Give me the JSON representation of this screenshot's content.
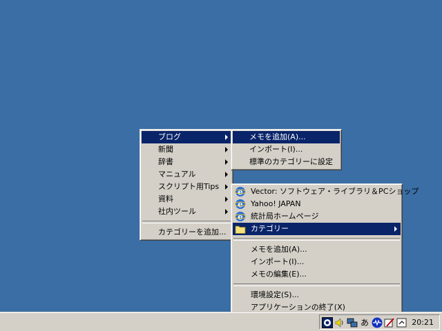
{
  "main_menu": {
    "items": [
      {
        "label": "ブログ",
        "submenu": true,
        "selected": true
      },
      {
        "label": "新聞",
        "submenu": true
      },
      {
        "label": "辞書",
        "submenu": true
      },
      {
        "label": "マニュアル",
        "submenu": true
      },
      {
        "label": "スクリプト用Tips",
        "submenu": true
      },
      {
        "label": "資料",
        "submenu": true
      },
      {
        "label": "社内ツール",
        "submenu": true
      }
    ],
    "add_category": "カテゴリーを追加..."
  },
  "blog_submenu": {
    "items": [
      {
        "label": "メモを追加(A)...",
        "selected": true
      },
      {
        "label": "インポート(I)..."
      },
      {
        "label": "標準のカテゴリーに設定"
      }
    ]
  },
  "tray_menu": {
    "links": [
      {
        "label": "Vector: ソフトウェア・ライブラリ＆PCショップ",
        "icon": "ie-icon"
      },
      {
        "label": "Yahoo! JAPAN",
        "icon": "ie-icon"
      },
      {
        "label": "統計局ホームページ",
        "icon": "ie-icon"
      }
    ],
    "category": {
      "label": "カテゴリー",
      "icon": "folder-icon",
      "selected": true
    },
    "memo_group": [
      {
        "label": "メモを追加(A)..."
      },
      {
        "label": "インポート(I)..."
      },
      {
        "label": "メモの編集(E)..."
      }
    ],
    "app_group": [
      {
        "label": "環境設定(S)..."
      },
      {
        "label": "アプリケーションの終了(X)"
      }
    ]
  },
  "taskbar": {
    "clock": "20:21",
    "tray_icons": [
      "app-tray-icon",
      "volume-icon",
      "network-icon",
      "ime-icon",
      "signal-icon",
      "tool-icon",
      "sync-icon"
    ],
    "ime_text": "あ"
  }
}
